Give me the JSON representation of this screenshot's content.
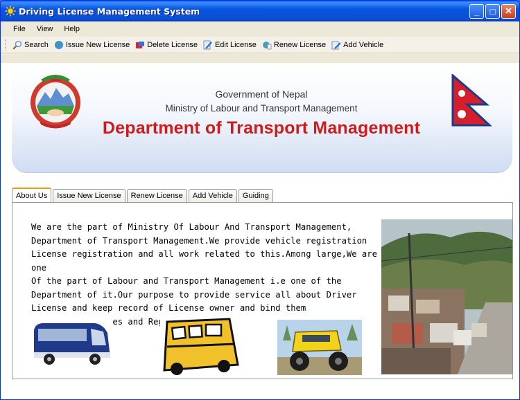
{
  "window": {
    "title": "Driving License Management System",
    "controls": {
      "minimize": "_",
      "maximize": "□",
      "close": "✕"
    }
  },
  "menu": [
    "File",
    "View",
    "Help"
  ],
  "toolbar": [
    {
      "label": "Search",
      "icon": "search-icon"
    },
    {
      "label": "Issue New License",
      "icon": "globe-icon"
    },
    {
      "label": "Delete License",
      "icon": "delete-icon"
    },
    {
      "label": "Edit License",
      "icon": "edit-icon"
    },
    {
      "label": "Renew License",
      "icon": "renew-icon"
    },
    {
      "label": "Add Vehicle",
      "icon": "vehicle-icon"
    }
  ],
  "banner": {
    "government": "Government of Nepal",
    "ministry": "Ministry of Labour and Transport Management",
    "department": "Department of Transport Management"
  },
  "tabs": [
    "About Us",
    "Issue New License",
    "Renew License",
    "Add Vehicle",
    "Guiding"
  ],
  "active_tab": "About Us",
  "about_text": "We are the part of Ministry Of Labour And Transport Management,\nDepartment of Transport Management.We provide vehicle registration\nLicense registration and all work related to this.Among large,We are one\nOf the part of Labour and Transport Management i.e one of the\nDepartment of it.Our purpose to provide service all about Driver\nLicense and keep record of License owner and bind them\nunder policy,Rules and Regulation.",
  "colors": {
    "titlebar": "#0a4fd4",
    "department_text": "#cc1d1d",
    "active_tab_accent": "#e89c0e"
  }
}
